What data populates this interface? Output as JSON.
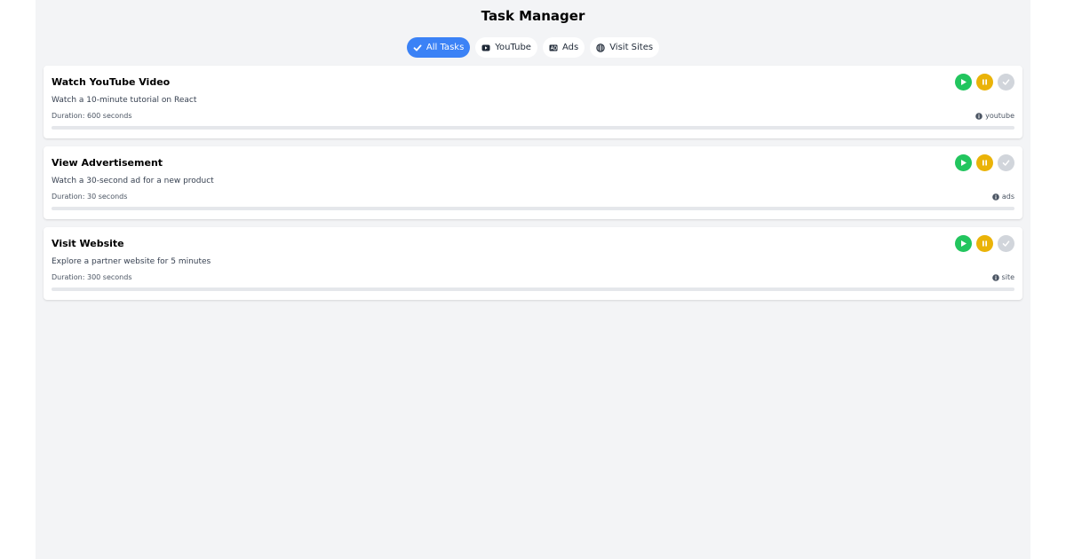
{
  "header": {
    "title": "Task Manager"
  },
  "filters": [
    {
      "label": "All Tasks",
      "icon": "check-icon",
      "active": true
    },
    {
      "label": "YouTube",
      "icon": "youtube-icon",
      "active": false
    },
    {
      "label": "Ads",
      "icon": "ad-icon",
      "active": false
    },
    {
      "label": "Visit Sites",
      "icon": "globe-icon",
      "active": false
    }
  ],
  "tasks": [
    {
      "title": "Watch YouTube Video",
      "description": "Watch a 10-minute tutorial on React",
      "duration": "Duration: 600 seconds",
      "source": "youtube",
      "progress": 0
    },
    {
      "title": "View Advertisement",
      "description": "Watch a 30-second ad for a new product",
      "duration": "Duration: 30 seconds",
      "source": "ads",
      "progress": 0
    },
    {
      "title": "Visit Website",
      "description": "Explore a partner website for 5 minutes",
      "duration": "Duration: 300 seconds",
      "source": "site",
      "progress": 0
    }
  ],
  "colors": {
    "accent": "#3b82f6",
    "play": "#22c55e",
    "pause": "#eab308",
    "complete": "#d1d5db",
    "background": "#f3f4f6"
  }
}
